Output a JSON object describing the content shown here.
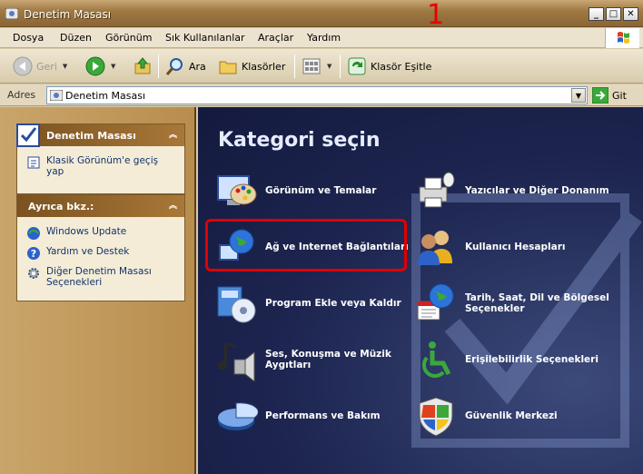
{
  "window": {
    "title": "Denetim Masası",
    "annotation": "1"
  },
  "menu": [
    "Dosya",
    "Düzen",
    "Görünüm",
    "Sık Kullanılanlar",
    "Araçlar",
    "Yardım"
  ],
  "toolbar": {
    "back": "Geri",
    "search": "Ara",
    "folders": "Klasörler",
    "folder_sync": "Klasör Eşitle"
  },
  "address": {
    "label": "Adres",
    "value": "Denetim Masası",
    "go": "Git"
  },
  "task_panel": {
    "header": "Denetim Masası",
    "links": [
      "Klasik Görünüm'e geçiş yap"
    ]
  },
  "see_also": {
    "header": "Ayrıca bkz.:",
    "links": [
      "Windows Update",
      "Yardım ve Destek",
      "Diğer Denetim Masası Seçenekleri"
    ]
  },
  "main": {
    "heading": "Kategori seçin",
    "categories": [
      "Görünüm ve Temalar",
      "Yazıcılar ve Diğer Donanım",
      "Ağ ve Internet Bağlantıları",
      "Kullanıcı Hesapları",
      "Program Ekle veya Kaldır",
      "Tarih, Saat, Dil ve Bölgesel Seçenekler",
      "Ses, Konuşma ve Müzik Aygıtları",
      "Erişilebilirlik Seçenekleri",
      "Performans ve Bakım",
      "Güvenlik Merkezi"
    ]
  },
  "colors": {
    "annotation_red": "#e00000",
    "content_bg": "#1d2550",
    "title_bar": "#a07a44"
  }
}
